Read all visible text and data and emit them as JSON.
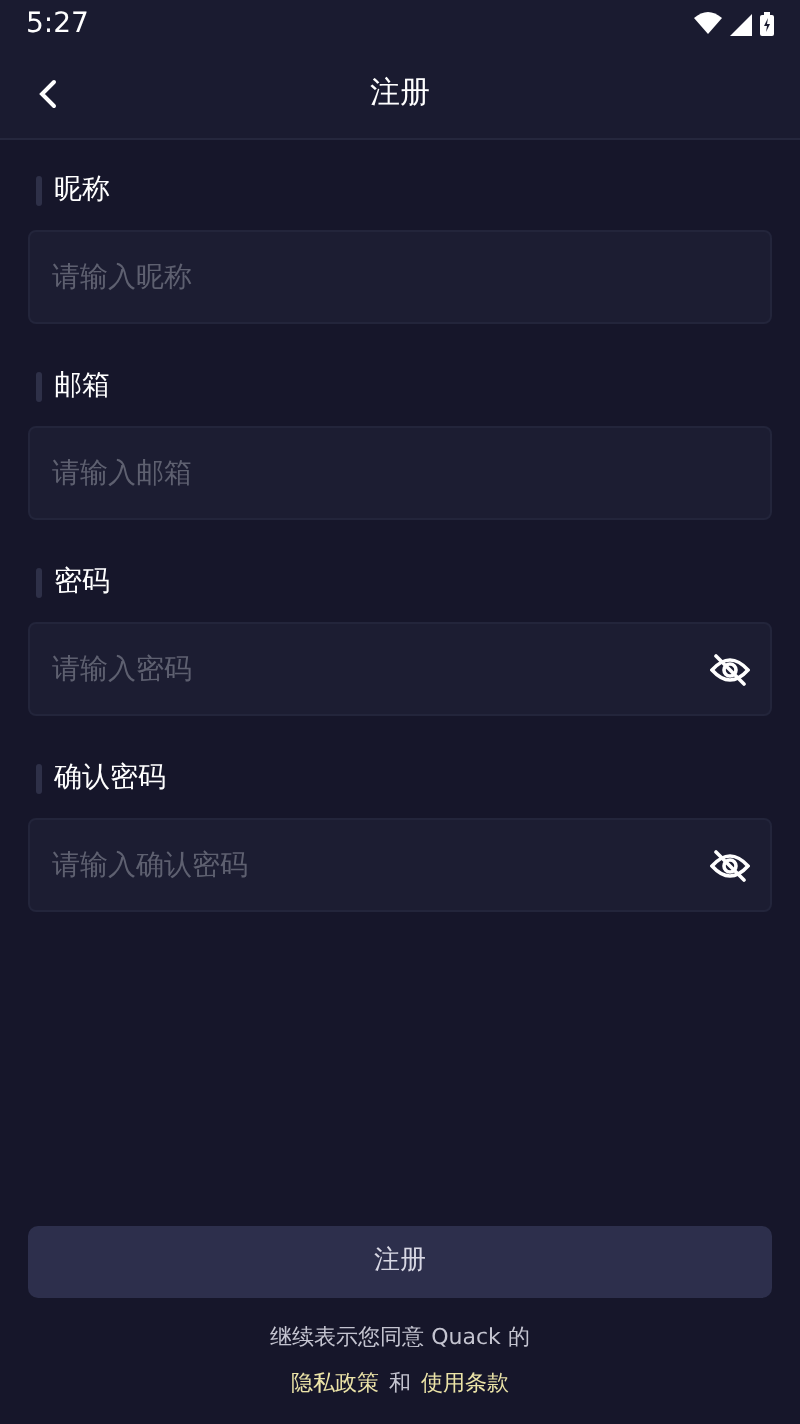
{
  "status_bar": {
    "time": "5:27"
  },
  "header": {
    "title": "注册"
  },
  "fields": [
    {
      "label": "昵称",
      "placeholder": "请输入昵称",
      "kind": "text"
    },
    {
      "label": "邮箱",
      "placeholder": "请输入邮箱",
      "kind": "text"
    },
    {
      "label": "密码",
      "placeholder": "请输入密码",
      "kind": "password"
    },
    {
      "label": "确认密码",
      "placeholder": "请输入确认密码",
      "kind": "password"
    }
  ],
  "submit_button": "注册",
  "terms": {
    "line_1": "继续表示您同意 Quack 的",
    "privacy_link": "隐私政策",
    "conjunction": "和",
    "terms_link": "使用条款"
  }
}
